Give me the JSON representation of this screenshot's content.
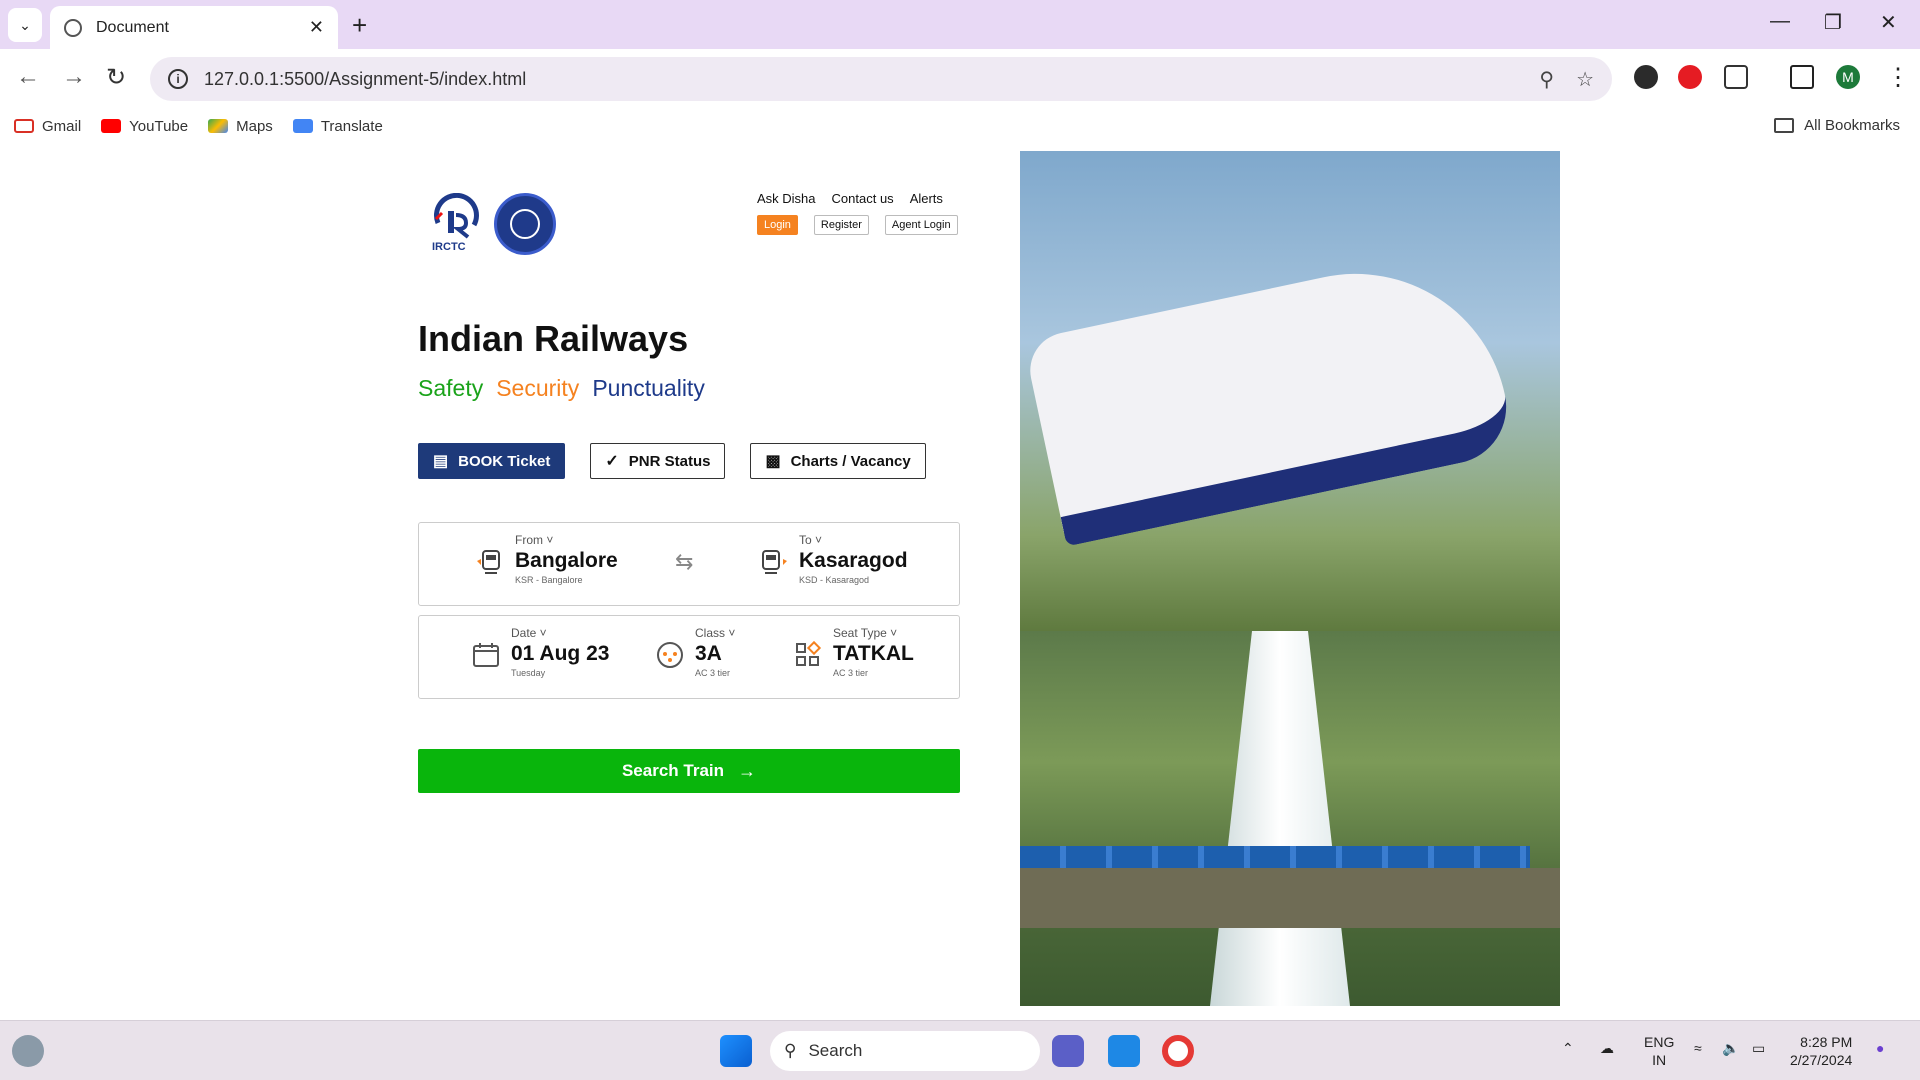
{
  "browser": {
    "tab_title": "Document",
    "url": "127.0.0.1:5500/Assignment-5/index.html",
    "profile_initial": "M",
    "bookmarks": [
      "Gmail",
      "YouTube",
      "Maps",
      "Translate"
    ],
    "all_bookmarks": "All Bookmarks"
  },
  "header": {
    "irctc_label": "IRCTC",
    "links": [
      "Ask Disha",
      "Contact us",
      "Alerts"
    ],
    "auth": [
      "Login",
      "Register",
      "Agent Login"
    ]
  },
  "hero_text": {
    "title": "Indian Railways",
    "tag_safety": "Safety",
    "tag_security": "Security",
    "tag_punctuality": "Punctuality"
  },
  "tabs": [
    "BOOK Ticket",
    "PNR Status",
    "Charts / Vacancy"
  ],
  "journey": {
    "from": {
      "label": "From",
      "value": "Bangalore",
      "sub": "KSR - Bangalore"
    },
    "to": {
      "label": "To",
      "value": "Kasaragod",
      "sub": "KSD - Kasaragod"
    },
    "date": {
      "label": "Date",
      "value": "01 Aug 23",
      "sub": "Tuesday"
    },
    "class": {
      "label": "Class",
      "value": "3A",
      "sub": "AC 3 tier"
    },
    "seat": {
      "label": "Seat Type",
      "value": "TATKAL",
      "sub": "AC 3 tier"
    }
  },
  "search_button": "Search Train",
  "taskbar": {
    "search_placeholder": "Search",
    "lang_top": "ENG",
    "lang_bottom": "IN",
    "time": "8:28 PM",
    "date": "2/27/2024"
  },
  "colors": {
    "brand_blue": "#1e3a7a",
    "accent_orange": "#f58220",
    "search_green": "#09b50c",
    "safety_green": "#1aa31a"
  }
}
